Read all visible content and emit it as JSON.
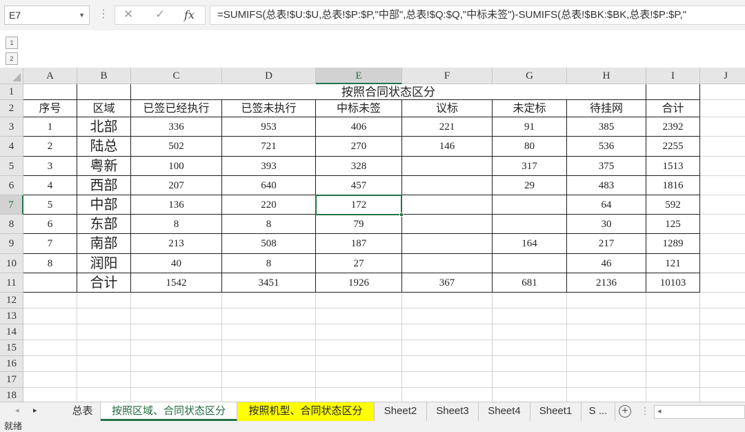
{
  "formula_bar": {
    "name_box": "E7",
    "separator": "⋮",
    "cancel_icon": "✕",
    "enter_icon": "✓",
    "fx_label": "fx",
    "formula": "=SUMIFS(总表!$U:$U,总表!$P:$P,\"中部\",总表!$Q:$Q,\"中标未签\")-SUMIFS(总表!$BK:$BK,总表!$P:$P,\""
  },
  "outline": {
    "levels": [
      "1",
      "2"
    ]
  },
  "columns": [
    "A",
    "B",
    "C",
    "D",
    "E",
    "F",
    "G",
    "H",
    "I",
    "J"
  ],
  "rows": [
    "1",
    "2",
    "3",
    "4",
    "5",
    "6",
    "7",
    "8",
    "9",
    "10",
    "11",
    "12",
    "13",
    "14",
    "15",
    "16",
    "17",
    "18"
  ],
  "selected_cell": "E7",
  "sheet": {
    "title": "按照合同状态区分",
    "headers": [
      "序号",
      "区域",
      "已签已经执行",
      "已签未执行",
      "中标未签",
      "议标",
      "未定标",
      "待挂网",
      "合计"
    ],
    "data": [
      [
        "1",
        "北部",
        "336",
        "953",
        "406",
        "221",
        "91",
        "385",
        "2392"
      ],
      [
        "2",
        "陆总",
        "502",
        "721",
        "270",
        "146",
        "80",
        "536",
        "2255"
      ],
      [
        "3",
        "粤新",
        "100",
        "393",
        "328",
        "",
        "317",
        "375",
        "1513"
      ],
      [
        "4",
        "西部",
        "207",
        "640",
        "457",
        "",
        "29",
        "483",
        "1816"
      ],
      [
        "5",
        "中部",
        "136",
        "220",
        "172",
        "",
        "",
        "64",
        "592"
      ],
      [
        "6",
        "东部",
        "8",
        "8",
        "79",
        "",
        "",
        "30",
        "125"
      ],
      [
        "7",
        "南部",
        "213",
        "508",
        "187",
        "",
        "164",
        "217",
        "1289"
      ],
      [
        "8",
        "润阳",
        "40",
        "8",
        "27",
        "",
        "",
        "46",
        "121"
      ],
      [
        "",
        "合计",
        "1542",
        "3451",
        "1926",
        "367",
        "681",
        "2136",
        "10103"
      ]
    ]
  },
  "tabs": [
    {
      "label": "总表",
      "style": "normal"
    },
    {
      "label": "按照区域、合同状态区分",
      "style": "green"
    },
    {
      "label": "按照机型、合同状态区分",
      "style": "yellow"
    },
    {
      "label": "Sheet2",
      "style": "normal"
    },
    {
      "label": "Sheet3",
      "style": "normal"
    },
    {
      "label": "Sheet4",
      "style": "normal"
    },
    {
      "label": "Sheet1",
      "style": "normal"
    },
    {
      "label": "S ...",
      "style": "normal"
    }
  ],
  "tab_nav": {
    "prev": "◂",
    "next": "▸",
    "add": "+",
    "more": "⋮",
    "scroll_left": "◂"
  },
  "status": {
    "text": "就绪"
  },
  "colors": {
    "accent": "#217346",
    "yellow_tab": "#ffff00"
  }
}
